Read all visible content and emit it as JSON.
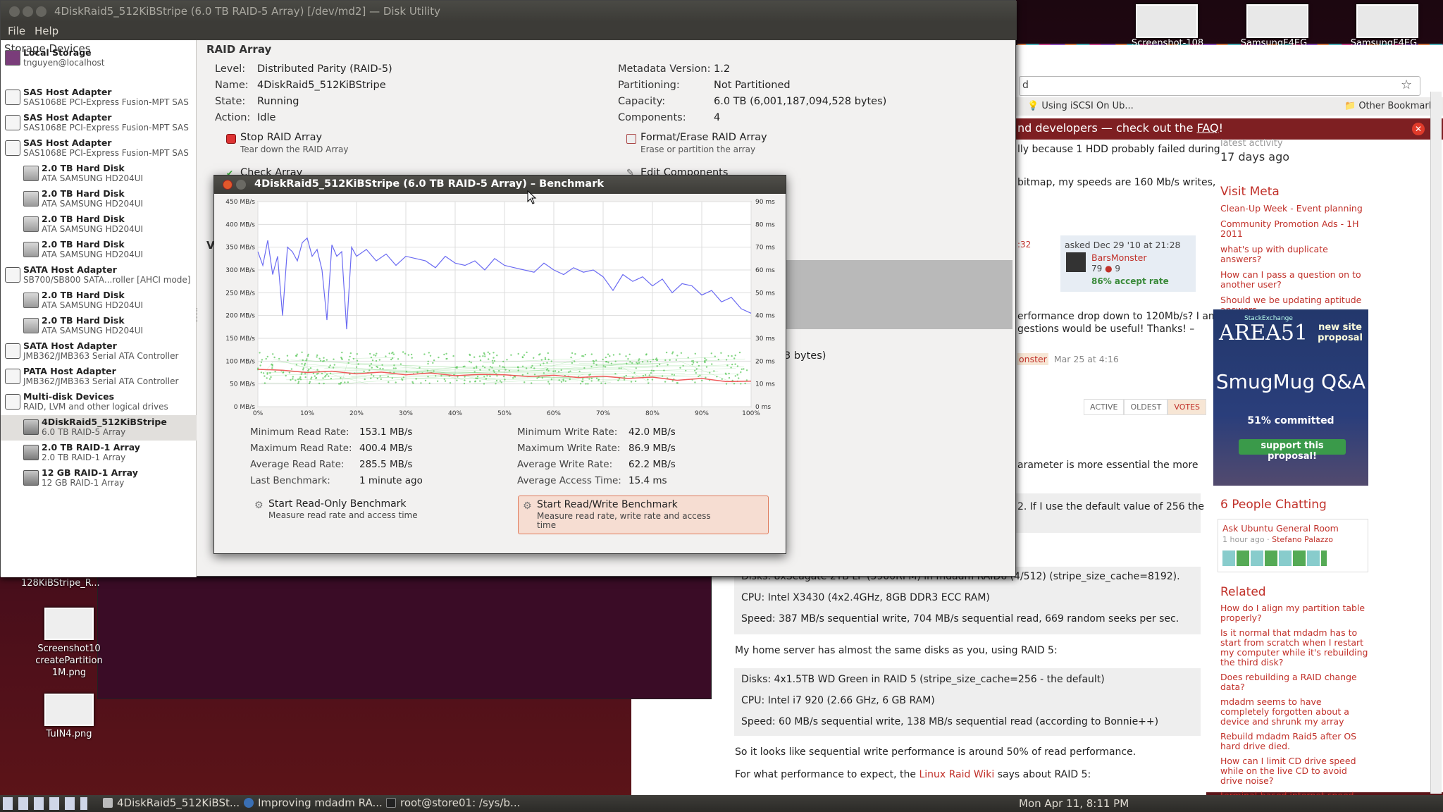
{
  "desktop": {
    "thumbs": [
      {
        "label": "Screenshot-108"
      },
      {
        "label": "SamsungF4EG"
      },
      {
        "label": "SamsungF4EG"
      }
    ],
    "icons": [
      {
        "label": "Screenshot10\ncreatePartition\n1M.png"
      },
      {
        "label": "TuIN4.png"
      }
    ],
    "partial_label": "128KiBStripe_R..."
  },
  "window": {
    "title": "4DiskRaid5_512KiBStripe (6.0 TB RAID-5 Array) [/dev/md2] — Disk Utility",
    "menu": [
      "File",
      "Help"
    ]
  },
  "sidebar": {
    "header": "Storage Devices",
    "items": [
      {
        "name": "Local Storage",
        "sub": "tnguyen@localhost",
        "icon": "computer-icon"
      },
      {
        "name": "SAS Host Adapter",
        "sub": "SAS1068E PCI-Express Fusion-MPT SAS",
        "icon": "hba-icon"
      },
      {
        "name": "SAS Host Adapter",
        "sub": "SAS1068E PCI-Express Fusion-MPT SAS",
        "icon": "hba-icon"
      },
      {
        "name": "SAS Host Adapter",
        "sub": "SAS1068E PCI-Express Fusion-MPT SAS",
        "icon": "hba-icon"
      },
      {
        "name": "2.0 TB Hard Disk",
        "sub": "ATA SAMSUNG HD204UI",
        "icon": "hard-disk-icon"
      },
      {
        "name": "2.0 TB Hard Disk",
        "sub": "ATA SAMSUNG HD204UI",
        "icon": "hard-disk-icon"
      },
      {
        "name": "2.0 TB Hard Disk",
        "sub": "ATA SAMSUNG HD204UI",
        "icon": "hard-disk-icon"
      },
      {
        "name": "2.0 TB Hard Disk",
        "sub": "ATA SAMSUNG HD204UI",
        "icon": "hard-disk-icon"
      },
      {
        "name": "SATA Host Adapter",
        "sub": "SB700/SB800 SATA...roller [AHCI mode]",
        "icon": "hba-icon"
      },
      {
        "name": "2.0 TB Hard Disk",
        "sub": "ATA SAMSUNG HD204UI",
        "icon": "hard-disk-icon"
      },
      {
        "name": "2.0 TB Hard Disk",
        "sub": "ATA SAMSUNG HD204UI",
        "icon": "hard-disk-icon"
      },
      {
        "name": "SATA Host Adapter",
        "sub": "JMB362/JMB363 Serial ATA Controller",
        "icon": "hba-icon"
      },
      {
        "name": "PATA Host Adapter",
        "sub": "JMB362/JMB363 Serial ATA Controller",
        "icon": "hba-icon"
      },
      {
        "name": "Multi-disk Devices",
        "sub": "RAID, LVM and other logical drives",
        "icon": "multidisk-icon"
      },
      {
        "name": "4DiskRaid5_512KiBStripe",
        "sub": "6.0 TB RAID-5 Array",
        "icon": "raid-icon"
      },
      {
        "name": "2.0 TB RAID-1 Array",
        "sub": "2.0 TB RAID-1 Array",
        "icon": "raid-icon"
      },
      {
        "name": "12 GB RAID-1 Array",
        "sub": "12 GB RAID-1 Array",
        "icon": "raid-icon"
      }
    ]
  },
  "raid": {
    "section_title": "RAID Array",
    "left": [
      {
        "label": "Level:",
        "value": "Distributed Parity (RAID-5)"
      },
      {
        "label": "Name:",
        "value": "4DiskRaid5_512KiBStripe"
      },
      {
        "label": "State:",
        "value": "Running"
      },
      {
        "label": "Action:",
        "value": "Idle"
      }
    ],
    "right": [
      {
        "label": "Metadata Version:",
        "value": "1.2"
      },
      {
        "label": "Partitioning:",
        "value": "Not Partitioned"
      },
      {
        "label": "Capacity:",
        "value": "6.0 TB (6,001,187,094,528 bytes)"
      },
      {
        "label": "Components:",
        "value": "4"
      }
    ],
    "actions": [
      {
        "title": "Stop RAID Array",
        "sub": "Tear down the RAID Array"
      },
      {
        "title": "Format/Erase RAID Array",
        "sub": "Erase or partition the array"
      },
      {
        "title": "Check Array",
        "sub": ""
      },
      {
        "title": "Edit Components",
        "sub": ""
      }
    ],
    "partial_vo": "Vo",
    "partial_bytes": "3 bytes)"
  },
  "benchmark": {
    "title": "4DiskRaid5_512KiBStripe (6.0 TB RAID-5 Array) – Benchmark",
    "left_stats": [
      {
        "label": "Minimum Read Rate:",
        "value": "153.1 MB/s"
      },
      {
        "label": "Maximum Read Rate:",
        "value": "400.4 MB/s"
      },
      {
        "label": "Average Read Rate:",
        "value": "285.5 MB/s"
      },
      {
        "label": "Last Benchmark:",
        "value": "1 minute ago"
      }
    ],
    "right_stats": [
      {
        "label": "Minimum Write Rate:",
        "value": "42.0 MB/s"
      },
      {
        "label": "Maximum Write Rate:",
        "value": "86.9 MB/s"
      },
      {
        "label": "Average Write Rate:",
        "value": "62.2 MB/s"
      },
      {
        "label": "Average Access Time:",
        "value": "15.4 ms"
      }
    ],
    "btn_ro": {
      "title": "Start Read-Only Benchmark",
      "sub": "Measure read rate and access time"
    },
    "btn_rw": {
      "title": "Start Read/Write Benchmark",
      "sub1": "Measure read rate, write rate and access",
      "sub2": "time"
    }
  },
  "chart_data": {
    "type": "line",
    "left_ticks": [
      "450 MB/s",
      "400 MB/s",
      "350 MB/s",
      "300 MB/s",
      "250 MB/s",
      "200 MB/s",
      "150 MB/s",
      "100 MB/s",
      "50 MB/s",
      "0 MB/s"
    ],
    "right_ticks": [
      "90 ms",
      "80 ms",
      "70 ms",
      "60 ms",
      "50 ms",
      "40 ms",
      "30 ms",
      "20 ms",
      "10 ms",
      "0 ms"
    ],
    "x_ticks": [
      "0%",
      "10%",
      "20%",
      "30%",
      "40%",
      "50%",
      "60%",
      "70%",
      "80%",
      "90%",
      "100%"
    ],
    "ylim_left": [
      0,
      450
    ],
    "ylim_right": [
      0,
      90
    ],
    "xlim": [
      0,
      100
    ],
    "grid": true,
    "colors": {
      "read": "#6b6bf2",
      "write": "#ef5a5a",
      "access": "#5cc85c"
    },
    "read_x": [
      0,
      1,
      2,
      3,
      4,
      5,
      6,
      7,
      8,
      9,
      10,
      11,
      12,
      13,
      14,
      15,
      16,
      17,
      18,
      19,
      20,
      22,
      24,
      26,
      28,
      30,
      32,
      34,
      36,
      38,
      40,
      42,
      44,
      46,
      48,
      50,
      52,
      54,
      56,
      58,
      60,
      62,
      64,
      66,
      68,
      70,
      72,
      74,
      76,
      78,
      80,
      82,
      84,
      86,
      88,
      90,
      92,
      94,
      96,
      98,
      100
    ],
    "read_y": [
      340,
      310,
      365,
      290,
      330,
      200,
      350,
      340,
      320,
      360,
      370,
      330,
      345,
      300,
      190,
      355,
      330,
      340,
      170,
      350,
      330,
      345,
      320,
      335,
      310,
      330,
      325,
      320,
      305,
      330,
      315,
      310,
      320,
      300,
      325,
      310,
      305,
      300,
      295,
      315,
      300,
      290,
      305,
      295,
      300,
      285,
      255,
      290,
      275,
      285,
      265,
      280,
      250,
      270,
      265,
      245,
      255,
      230,
      240,
      215,
      205
    ],
    "write_x": [
      0,
      5,
      10,
      15,
      20,
      25,
      30,
      35,
      40,
      45,
      50,
      55,
      60,
      65,
      70,
      75,
      80,
      85,
      90,
      95,
      100
    ],
    "write_y": [
      82,
      80,
      75,
      78,
      72,
      76,
      70,
      74,
      68,
      71,
      70,
      66,
      69,
      64,
      67,
      62,
      65,
      58,
      62,
      55,
      56
    ],
    "access_band": {
      "low": 10,
      "high": 24
    }
  },
  "browser": {
    "url_partial": "d",
    "bookmarks": [
      "Using iSCSI On Ub...",
      "Other Bookmarks"
    ],
    "notice": "nd developers — check out the ",
    "notice_link": "FAQ",
    "notice_end": "!",
    "q_snippets": [
      "lly because 1 HDD probably failed during",
      "bitmap, my speeds are 160 Mb/s writes,",
      "erformance drop down to 120Mb/s? I am",
      "gestions would be useful! Thanks! –",
      "arameter is more essential the more",
      "2. If I use the default value of 256 the"
    ],
    "asked": "asked Dec 29 '10 at 21:28",
    "asked_user": "BarsMonster",
    "asked_rep": "79",
    "asked_badges": "9",
    "accept_rate": "86% accept rate",
    "comment_user": "onster",
    "comment_time": "Mar 25 at 4:16",
    "comment_link_time": ":32",
    "sort_tabs": [
      "ACTIVE",
      "OLDEST",
      "VOTES"
    ],
    "latest_activity_label": "latest activity",
    "latest_activity": "17 days ago",
    "meta_title": "Visit Meta",
    "meta_links": [
      "Clean-Up Week - Event planning",
      "Community Promotion Ads - 1H 2011",
      "what's up with duplicate answers?",
      "How can I pass a question on to another user?",
      "Should we be updating aptitude answers"
    ],
    "area51": {
      "brand": "StackExchange",
      "logo": "AREA51",
      "proposal": "new site proposal",
      "title": "SmugMug Q&A",
      "committed": "51% committed",
      "support": "support this proposal!"
    },
    "chat_title": "6 People Chatting",
    "chat_room": "Ask Ubuntu General Room",
    "chat_time": "1 hour ago",
    "chat_user": "Stefano Palazzo",
    "related_title": "Related",
    "related_links": [
      "How do I align my partition table properly?",
      "Is it normal that mdadm has to start from scratch when I restart my computer while it's rebuilding the third disk?",
      "Does rebuilding a RAID change data?",
      "mdadm seems to have completely forgotten about a device and shrunk my array",
      "Rebuild mdadm Raid5 after OS hard drive died.",
      "How can I limit CD drive speed while on the live CD to avoid drive noise?",
      "terminal-based internet speed test"
    ],
    "answer": {
      "disks1": "Disks: 8xSeagate 2TB LP (5900RPM) in mdadm RAID6 (4/512) (stripe_size_cache=8192).",
      "cpu1": "CPU: Intel X3430 (4x2.4GHz, 8GB DDR3 ECC RAM)",
      "speed1": "Speed: 387 MB/s sequential write, 704 MB/s sequential read, 669 random seeks per sec.",
      "home": "My home server has almost the same disks as you, using RAID 5:",
      "disks2": "Disks: 4x1.5TB WD Green in RAID 5 (stripe_size_cache=256 - the default)",
      "cpu2": "CPU: Intel i7 920 (2.66 GHz, 6 GB RAM)",
      "speed2": "Speed: 60 MB/s sequential write, 138 MB/s sequential read (according to Bonnie++)",
      "concl": "So it looks like sequential write performance is around 50% of read performance.",
      "expect_pre": "For what performance to expect, the ",
      "expect_link": "Linux Raid Wiki",
      "expect_post": " says about RAID 5:"
    }
  },
  "taskbar": {
    "tasks": [
      "4DiskRaid5_512KiBSt...",
      "Improving mdadm RA...",
      "root@store01: /sys/b..."
    ],
    "clock": "Mon Apr 11,  8:11 PM"
  }
}
